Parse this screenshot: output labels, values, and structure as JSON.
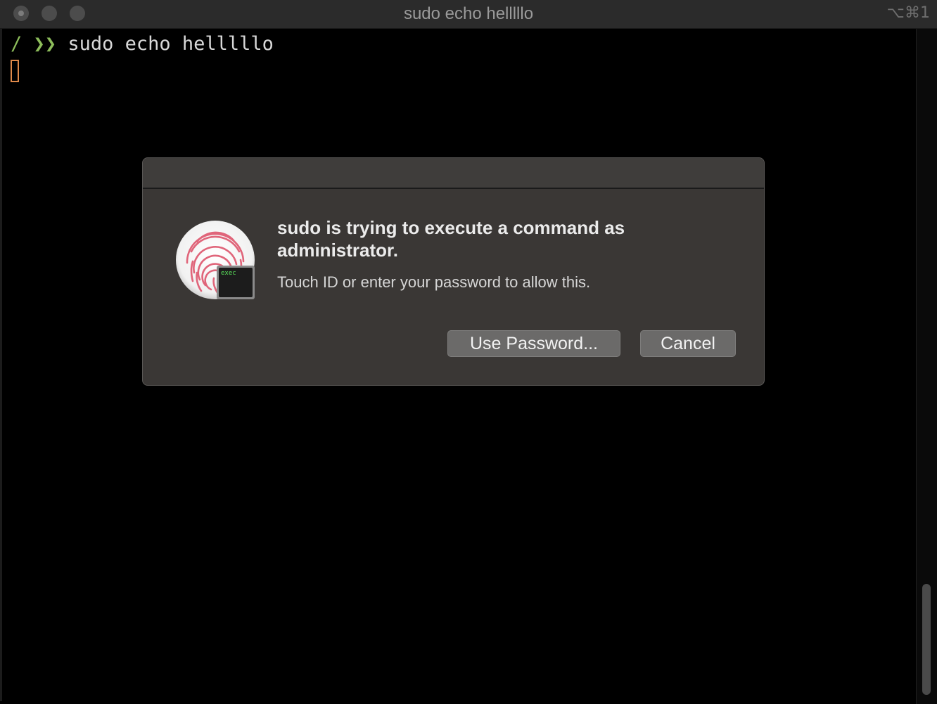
{
  "window": {
    "title": "sudo echo helllllo",
    "shortcut": "⌥⌘1"
  },
  "terminal": {
    "prompt_path": "/",
    "prompt_symbol": "❯❯",
    "command": "sudo echo helllllo"
  },
  "dialog": {
    "heading": "sudo is trying to execute a command as administrator.",
    "message": "Touch ID or enter your password to allow this.",
    "icon_badge_text": "exec",
    "use_password_label": "Use Password...",
    "cancel_label": "Cancel"
  },
  "colors": {
    "prompt_green": "#8dbd5b",
    "cursor_orange": "#e08a4a",
    "fingerprint_pink": "#e0657a",
    "dialog_bg": "#3a3735"
  },
  "icons": {
    "fingerprint": "touch-id-fingerprint-icon",
    "terminal_badge": "terminal-exec-icon"
  }
}
